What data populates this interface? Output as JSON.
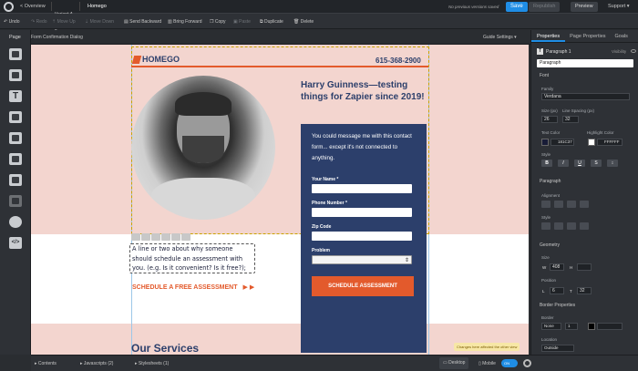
{
  "topbar": {
    "back_label": "< Overview",
    "variant_label": "Variant A",
    "variant_caret": "▾",
    "page_title": "Homego",
    "versions_status": "No previous versions saved",
    "save_label": "Save",
    "republish_label": "Republish",
    "preview_label": "Preview",
    "support_label": "Support ▾"
  },
  "toolbar": {
    "undo": "Undo",
    "redo": "Redo",
    "move_up": "Move Up",
    "move_down": "Move Down",
    "send_backward": "Send Backward",
    "bring_forward": "Bring Forward",
    "copy": "Copy",
    "paste": "Paste",
    "duplicate": "Duplicate",
    "delete": "Delete"
  },
  "left": {
    "tab_label": "Page"
  },
  "canvas_header": {
    "title": "Form Confirmation Dialog",
    "guide_settings": "Guide Settings ▾"
  },
  "page": {
    "logo_text": "HOMEGO",
    "phone": "615-368-2900",
    "headline": "Harry Guinness—testing things for Zapier since 2019!",
    "form_intro": "You could message me with this contact form... except it's not connected to anything.",
    "fields": [
      {
        "label": "Your Name *"
      },
      {
        "label": "Phone Number *"
      },
      {
        "label": "Zip Code"
      },
      {
        "label": "Problem"
      }
    ],
    "submit_label": "SCHEDULE ASSESSMENT",
    "paragraph_text": "A line or two about why someone should schedule an assessment with you. (e.g. Is it convenient? Is it free?);",
    "cta_label": "SCHEDULE A FREE ASSESSMENT",
    "cta_arrows": "▶ ▶",
    "services_heading": "Our Services"
  },
  "right": {
    "tabs": [
      "Properties",
      "Page Properties",
      "Goals"
    ],
    "element_name": "Paragraph 1",
    "visibility_label": "Visibility",
    "type_select": "Paragraph",
    "font_section": "Font",
    "family_label": "Family",
    "family_value": "Verdana",
    "size_label": "Size (px)",
    "line_spacing_label": "Line Spacing (px)",
    "size_value": "26",
    "line_value": "32",
    "text_color_label": "Text Color",
    "text_color_hex": "181C37",
    "highlight_label": "Highlight Color",
    "highlight_hex": "FFFFFF",
    "style_label": "Style",
    "paragraph_section": "Paragraph",
    "alignment_label": "Alignment",
    "style2_label": "Style",
    "geometry_section": "Geometry",
    "size_geo_label": "Size",
    "w_label": "W",
    "w_value": "408",
    "h_label": "H",
    "position_label": "Position",
    "l_label": "L",
    "l_value": "6",
    "t_label": "T",
    "t_value": "32",
    "border_section": "Border Properties",
    "border_label": "Border",
    "border_style": "None",
    "border_width": "1",
    "location_label": "Location",
    "location_value": "Outside",
    "apply_to_label": "Apply to"
  },
  "bottom": {
    "contents": "Contents",
    "javascripts": "Javascripts",
    "javascripts_count": "(2)",
    "stylesheets": "Stylesheets",
    "stylesheets_count": "(1)",
    "tooltip": "Changes here affected the other view",
    "desktop": "Desktop",
    "mobile": "Mobile",
    "toggle": "ON"
  },
  "colors": {
    "accent": "#1f8de5",
    "brand_navy": "#2c3f6b",
    "brand_orange": "#e35a2c",
    "peach": "#f3d5cf",
    "text_color_swatch": "#181c37"
  }
}
